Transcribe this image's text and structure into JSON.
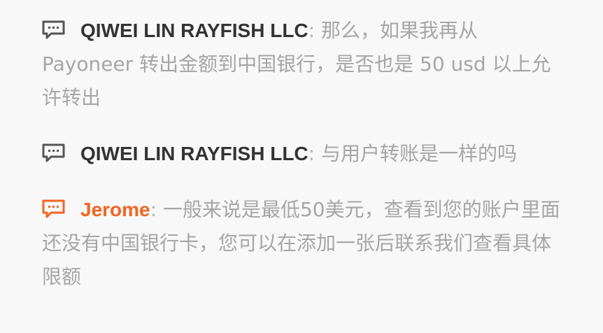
{
  "messages": [
    {
      "author": "QIWEI LIN RAYFISH LLC",
      "separator": ": ",
      "text": "那么，如果我再从 Payoneer 转出金额到中国银行，是否也是 50 usd 以上允许转出",
      "icon": "chat-bubble-icon",
      "icon_color": "#555555"
    },
    {
      "author": "QIWEI LIN RAYFISH LLC",
      "separator": ": ",
      "text": "与用户转账是一样的吗",
      "icon": "chat-bubble-icon",
      "icon_color": "#555555"
    },
    {
      "author": "Jerome",
      "separator": ": ",
      "text": "一般来说是最低50美元，查看到您的账户里面还没有中国银行卡，您可以在添加一张后联系我们查看具体限额",
      "icon": "chat-bubble-icon",
      "icon_color": "#f26522"
    }
  ],
  "colors": {
    "background": "#f8f8f8",
    "customer_name": "#333333",
    "staff_name": "#f26522",
    "message_text": "#a6a6a6"
  }
}
